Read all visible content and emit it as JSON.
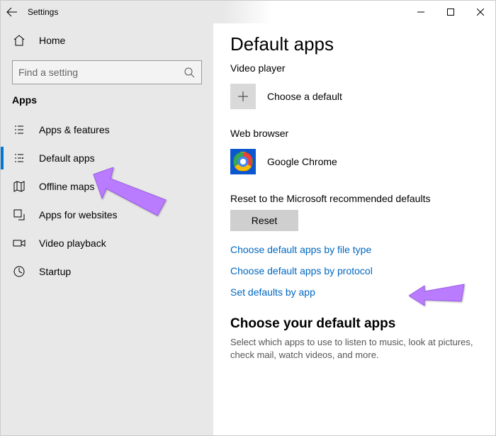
{
  "titlebar": {
    "title": "Settings"
  },
  "sidebar": {
    "home": "Home",
    "search_placeholder": "Find a setting",
    "category": "Apps",
    "items": [
      {
        "label": "Apps & features"
      },
      {
        "label": "Default apps"
      },
      {
        "label": "Offline maps"
      },
      {
        "label": "Apps for websites"
      },
      {
        "label": "Video playback"
      },
      {
        "label": "Startup"
      }
    ]
  },
  "content": {
    "title": "Default apps",
    "video_label": "Video player",
    "video_default": "Choose a default",
    "web_label": "Web browser",
    "web_default": "Google Chrome",
    "reset_line": "Reset to the Microsoft recommended defaults",
    "reset_button": "Reset",
    "link_file_type": "Choose default apps by file type",
    "link_protocol": "Choose default apps by protocol",
    "link_by_app": "Set defaults by app",
    "choose_head": "Choose your default apps",
    "choose_sub": "Select which apps to use to listen to music, look at pictures, check mail, watch videos, and more."
  }
}
